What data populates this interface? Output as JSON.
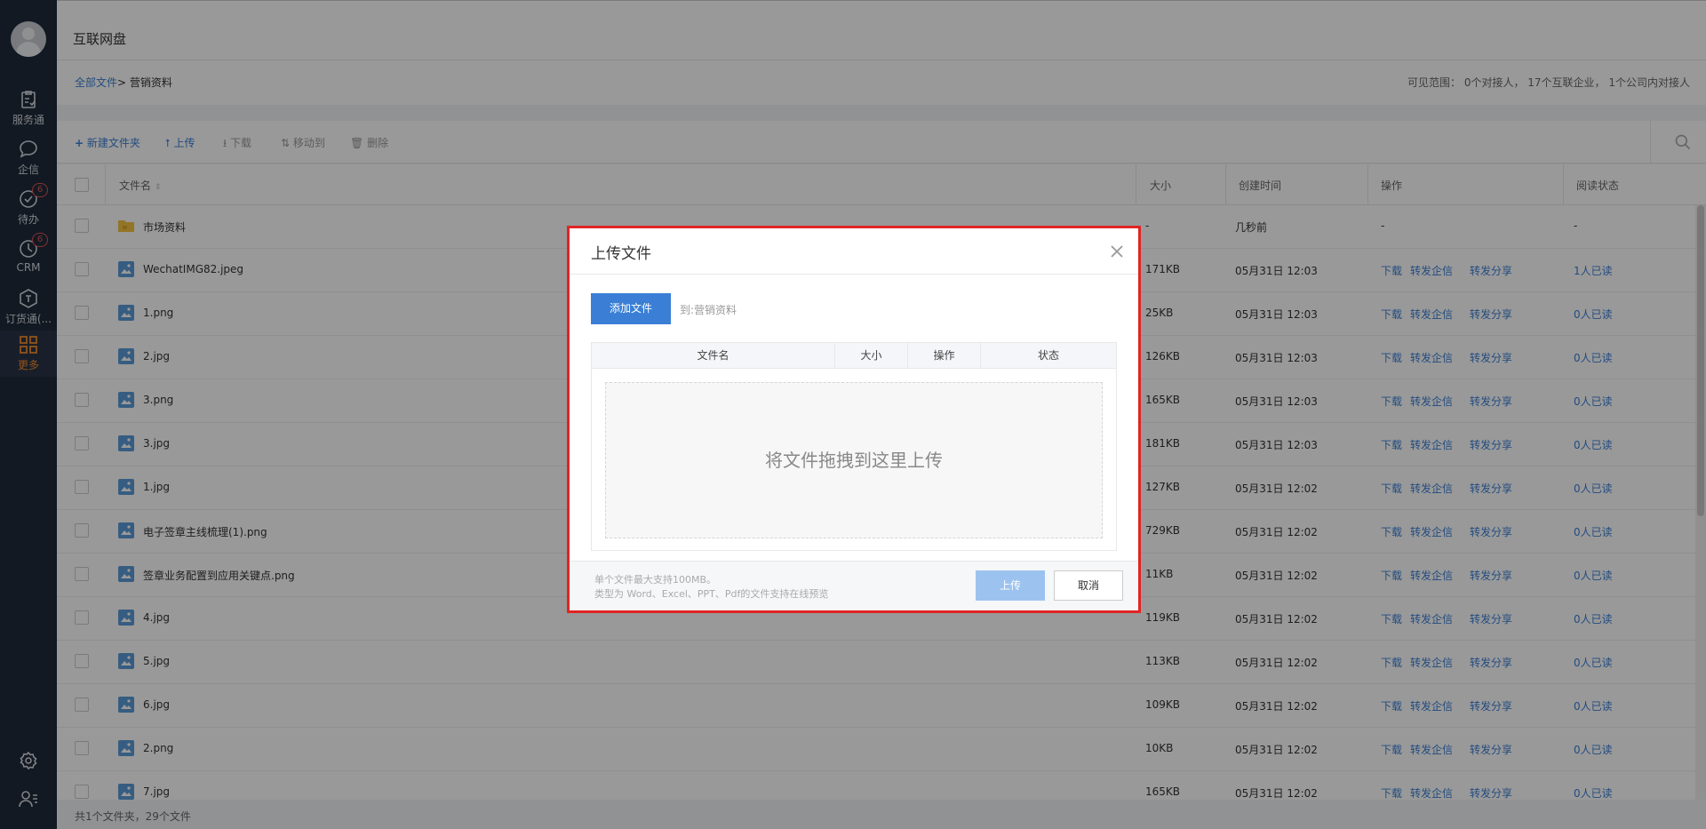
{
  "sidebar": {
    "items": [
      {
        "label": "服务通",
        "icon": "service-icon"
      },
      {
        "label": "企信",
        "icon": "chat-icon"
      },
      {
        "label": "待办",
        "icon": "todo-icon",
        "badge": "6"
      },
      {
        "label": "CRM",
        "icon": "crm-icon",
        "badge": "6"
      },
      {
        "label": "订货通(...",
        "icon": "order-icon"
      },
      {
        "label": "更多",
        "icon": "grid-icon",
        "active": true
      }
    ]
  },
  "header": {
    "title": "互联网盘"
  },
  "breadcrumb": {
    "root": "全部文件",
    "separator": ">",
    "current": "营销资料"
  },
  "visible_range": "可见范围： 0个对接人， 17个互联企业， 1个公司内对接人",
  "toolbar": {
    "new_folder": "新建文件夹",
    "upload": "上传",
    "download": "下载",
    "move_to": "移动到",
    "delete": "删除"
  },
  "table": {
    "columns": [
      "文件名",
      "大小",
      "创建时间",
      "操作",
      "阅读状态"
    ],
    "op_labels": [
      "下载",
      "转发企信",
      "转发分享"
    ],
    "rows": [
      {
        "name": "市场资料",
        "type": "folder",
        "size": "-",
        "time": "几秒前",
        "op": "-",
        "read": "-"
      },
      {
        "name": "WechatIMG82.jpeg",
        "type": "image",
        "size": "171KB",
        "time": "05月31日 12:03",
        "read": "1人已读"
      },
      {
        "name": "1.png",
        "type": "image",
        "size": "25KB",
        "time": "05月31日 12:03",
        "read": "0人已读"
      },
      {
        "name": "2.jpg",
        "type": "image",
        "size": "126KB",
        "time": "05月31日 12:03",
        "read": "0人已读"
      },
      {
        "name": "3.png",
        "type": "image",
        "size": "165KB",
        "time": "05月31日 12:03",
        "read": "0人已读"
      },
      {
        "name": "3.jpg",
        "type": "image",
        "size": "181KB",
        "time": "05月31日 12:03",
        "read": "0人已读"
      },
      {
        "name": "1.jpg",
        "type": "image",
        "size": "127KB",
        "time": "05月31日 12:02",
        "read": "0人已读"
      },
      {
        "name": "电子签章主线梳理(1).png",
        "type": "image",
        "size": "729KB",
        "time": "05月31日 12:02",
        "read": "0人已读"
      },
      {
        "name": "签章业务配置到应用关键点.png",
        "type": "image",
        "size": "11KB",
        "time": "05月31日 12:02",
        "read": "0人已读"
      },
      {
        "name": "4.jpg",
        "type": "image",
        "size": "119KB",
        "time": "05月31日 12:02",
        "read": "0人已读"
      },
      {
        "name": "5.jpg",
        "type": "image",
        "size": "113KB",
        "time": "05月31日 12:02",
        "read": "0人已读"
      },
      {
        "name": "6.jpg",
        "type": "image",
        "size": "109KB",
        "time": "05月31日 12:02",
        "read": "0人已读"
      },
      {
        "name": "2.png",
        "type": "image",
        "size": "10KB",
        "time": "05月31日 12:02",
        "read": "0人已读"
      },
      {
        "name": "7.jpg",
        "type": "image",
        "size": "165KB",
        "time": "05月31日 12:02",
        "read": "0人已读"
      }
    ]
  },
  "footer": {
    "summary": "共1个文件夹，29个文件"
  },
  "modal": {
    "title": "上传文件",
    "add_file": "添加文件",
    "destination": "到:营销资料",
    "columns": [
      "文件名",
      "大小",
      "操作",
      "状态"
    ],
    "dropzone": "将文件拖拽到这里上传",
    "note_1": "单个文件最大支持100MB。",
    "note_2": "类型为 Word、Excel、PPT、Pdf的文件支持在线预览",
    "upload": "上传",
    "cancel": "取消"
  },
  "colors": {
    "accent": "#3a7fd5",
    "sidebar": "#1f2a3a",
    "active_nav": "#f28a2e",
    "highlight": "#e02424",
    "folder": "#f5c342",
    "image_icon": "#5b9bd8"
  }
}
